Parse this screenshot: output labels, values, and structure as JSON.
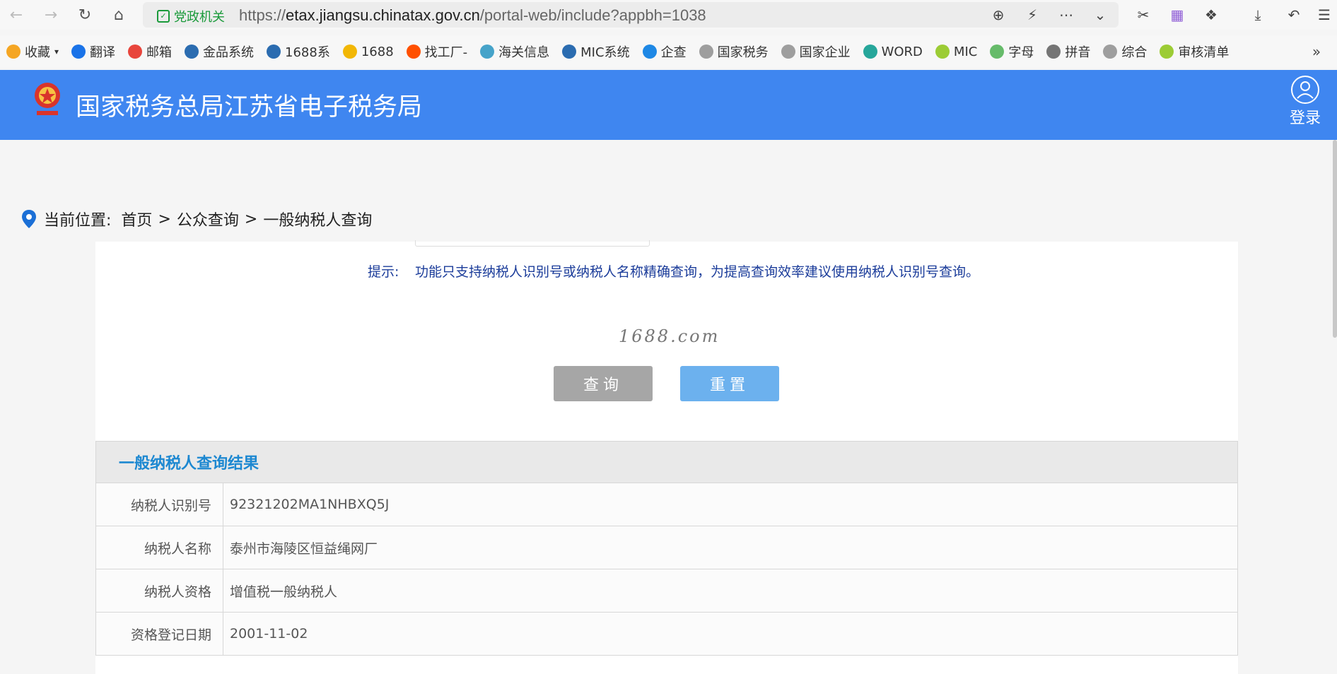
{
  "browser": {
    "gov_badge": "党政机关",
    "url_prefix": "https://",
    "url_host": "etax.jiangsu.chinatax.gov.cn",
    "url_path": "/portal-web/include?appbh=1038"
  },
  "bookmarks": [
    {
      "label": "收藏",
      "icon": "star-icon",
      "color": "#f5a623"
    },
    {
      "label": "翻译",
      "icon": "translate-icon",
      "color": "#1a73e8"
    },
    {
      "label": "邮箱",
      "icon": "mail-icon",
      "color": "#e8453c"
    },
    {
      "label": "金品系统",
      "icon": "triangle-icon",
      "color": "#2b6cb0"
    },
    {
      "label": "1688系",
      "icon": "triangle-icon",
      "color": "#2b6cb0"
    },
    {
      "label": "1688",
      "icon": "1688-icon",
      "color": "#f2b705"
    },
    {
      "label": "找工厂-",
      "icon": "taobao-icon",
      "color": "#ff5000"
    },
    {
      "label": "海关信息",
      "icon": "customs-icon",
      "color": "#46a3c9"
    },
    {
      "label": "MIC系统",
      "icon": "triangle-icon",
      "color": "#2b6cb0"
    },
    {
      "label": "企查",
      "icon": "qichacha-icon",
      "color": "#1e88e5"
    },
    {
      "label": "国家税务",
      "icon": "globe-icon",
      "color": "#9e9e9e"
    },
    {
      "label": "国家企业",
      "icon": "globe-icon",
      "color": "#9e9e9e"
    },
    {
      "label": "WORD",
      "icon": "refresh-icon",
      "color": "#26a69a"
    },
    {
      "label": "MIC",
      "icon": "leaf-icon",
      "color": "#9ccc35"
    },
    {
      "label": "字母",
      "icon": "frog-icon",
      "color": "#66bb6a"
    },
    {
      "label": "拼音",
      "icon": "puzzle-icon",
      "color": "#757575"
    },
    {
      "label": "综合",
      "icon": "globe-icon",
      "color": "#9e9e9e"
    },
    {
      "label": "审核清单",
      "icon": "leaf-icon",
      "color": "#9ccc35"
    }
  ],
  "header": {
    "title": "国家税务总局江苏省电子税务局",
    "login_label": "登录"
  },
  "breadcrumb": {
    "prefix": "当前位置:",
    "items": [
      "首页",
      "公众查询",
      "一般纳税人查询"
    ],
    "separator": ">"
  },
  "search": {
    "hint_label": "提示:",
    "hint_text": "功能只支持纳税人识别号或纳税人名称精确查询，为提高查询效率建议使用纳税人识别号查询。",
    "watermark": "1688.com",
    "query_button": "查询",
    "reset_button": "重置"
  },
  "results": {
    "title": "一般纳税人查询结果",
    "rows": [
      {
        "label": "纳税人识别号",
        "value": "92321202MA1NHBXQ5J"
      },
      {
        "label": "纳税人名称",
        "value": "泰州市海陵区恒益绳网厂"
      },
      {
        "label": "纳税人资格",
        "value": "增值税一般纳税人"
      },
      {
        "label": "资格登记日期",
        "value": "2001-11-02"
      }
    ]
  }
}
